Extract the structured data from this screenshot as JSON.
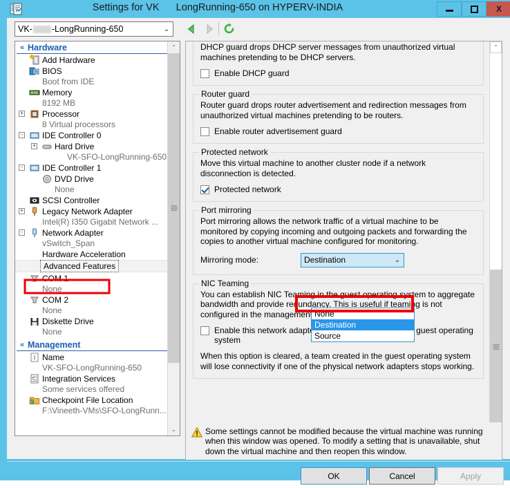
{
  "window": {
    "title": "Settings for VK      LongRunning-650 on HYPERV-INDIA",
    "app_icon": "settings-document-icon",
    "minimize_label": "",
    "maximize_label": "",
    "close_label": "X",
    "accent_color": "#5bc3e8",
    "close_color": "#c7584f"
  },
  "toolbar": {
    "vm_selector_value_prefix": "VK-",
    "vm_selector_value_suffix": "-LongRunning-650",
    "vm_selector_arrow": "⌄",
    "back_icon": "back-arrow-icon",
    "forward_icon": "forward-arrow-icon",
    "refresh_icon": "refresh-icon"
  },
  "sidebar": {
    "sections": [
      {
        "label": "Hardware",
        "chevron": "«",
        "items": [
          {
            "label": "Add Hardware",
            "icon": "add-hardware-icon",
            "sub": null,
            "expander": null,
            "indent": 1
          },
          {
            "label": "BIOS",
            "icon": "bios-icon",
            "sub": "Boot from IDE",
            "expander": null,
            "indent": 1
          },
          {
            "label": "Memory",
            "icon": "memory-icon",
            "sub": "8192 MB",
            "expander": null,
            "indent": 1
          },
          {
            "label": "Processor",
            "icon": "processor-icon",
            "sub": "8 Virtual processors",
            "expander": "+",
            "indent": 1
          },
          {
            "label": "IDE Controller 0",
            "icon": "ide-controller-icon",
            "sub": null,
            "expander": "-",
            "indent": 1
          },
          {
            "label": "Hard Drive",
            "icon": "hard-drive-icon",
            "sub": "VK-SFO-LongRunning-650....",
            "expander": "+",
            "indent": 2
          },
          {
            "label": "IDE Controller 1",
            "icon": "ide-controller-icon",
            "sub": null,
            "expander": "-",
            "indent": 1
          },
          {
            "label": "DVD Drive",
            "icon": "dvd-drive-icon",
            "sub": "None",
            "expander": null,
            "indent": 2
          },
          {
            "label": "SCSI Controller",
            "icon": "scsi-controller-icon",
            "sub": null,
            "expander": null,
            "indent": 1
          },
          {
            "label": "Legacy Network Adapter",
            "icon": "network-adapter-icon",
            "sub": "Intel(R) I350 Gigabit Network ...",
            "expander": "+",
            "indent": 1
          },
          {
            "label": "Network Adapter",
            "icon": "network-adapter-icon",
            "sub": "vSwitch_Span",
            "expander": "-",
            "indent": 1
          },
          {
            "label": "Hardware Acceleration",
            "icon": null,
            "sub": null,
            "expander": null,
            "indent": 1
          },
          {
            "label": "Advanced Features",
            "icon": null,
            "sub": null,
            "expander": null,
            "indent": 1,
            "selected": true,
            "annotated": true
          },
          {
            "label": "COM 1",
            "icon": "com-port-icon",
            "sub": "None",
            "expander": null,
            "indent": 1
          },
          {
            "label": "COM 2",
            "icon": "com-port-icon",
            "sub": "None",
            "expander": null,
            "indent": 1
          },
          {
            "label": "Diskette Drive",
            "icon": "diskette-drive-icon",
            "sub": "None",
            "expander": null,
            "indent": 1
          }
        ]
      },
      {
        "label": "Management",
        "chevron": "«",
        "items": [
          {
            "label": "Name",
            "icon": "name-icon",
            "sub": "VK-SFO-LongRunning-650",
            "expander": null,
            "indent": 1
          },
          {
            "label": "Integration Services",
            "icon": "integration-services-icon",
            "sub": "Some services offered",
            "expander": null,
            "indent": 1
          },
          {
            "label": "Checkpoint File Location",
            "icon": "checkpoint-folder-icon",
            "sub": "F:\\Vineeth-VMs\\SFO-LongRunn...",
            "expander": null,
            "indent": 1
          }
        ]
      }
    ],
    "scroll_up_arrow": "⌃",
    "scroll_down_arrow": "⌄"
  },
  "main": {
    "groups": [
      {
        "title": "",
        "title_hidden": true,
        "text": "DHCP guard drops DHCP server messages from unauthorized virtual machines pretending to be DHCP servers.",
        "checkbox": {
          "label": "Enable DHCP guard",
          "checked": false
        }
      },
      {
        "title": "Router guard",
        "text": "Router guard drops router advertisement and redirection messages from unauthorized virtual machines pretending to be routers.",
        "checkbox": {
          "label": "Enable router advertisement guard",
          "checked": false
        }
      },
      {
        "title": "Protected network",
        "text": "Move this virtual machine to another cluster node if a network disconnection is detected.",
        "checkbox": {
          "label": "Protected network",
          "checked": true
        }
      },
      {
        "title": "Port mirroring",
        "text": "Port mirroring allows the network traffic of a virtual machine to be monitored by copying incoming and outgoing packets and forwarding the copies to another virtual machine configured for monitoring.",
        "mirror_label": "Mirroring mode:",
        "mirror_value": "Destination",
        "mirror_arrow": "⌄"
      },
      {
        "title": "NIC Teaming",
        "text": "You can establish NIC Teaming in the guest operating system to aggregate bandwidth and provide redundancy. This is useful if teaming is not configured in the management operating system.",
        "checkbox": {
          "label": "Enable this network adapter to be part of a team in the guest operating system",
          "checked": false
        },
        "footer_text": "When this option is cleared, a team created in the guest operating system will lose connectivity if one of the physical network adapters stops working."
      }
    ],
    "dropdown_options": [
      {
        "label": "None",
        "selected": false
      },
      {
        "label": "Destination",
        "selected": true
      },
      {
        "label": "Source",
        "selected": false
      }
    ],
    "scroll_up_arrow": "⌃",
    "scroll_down_arrow": "⌄"
  },
  "warning": {
    "icon": "warning-triangle-icon",
    "text": "Some settings cannot be modified because the virtual machine was running when this window was opened. To modify a setting that is unavailable, shut down the virtual machine and then reopen this window."
  },
  "footer": {
    "ok_label": "OK",
    "cancel_label": "Cancel",
    "apply_label": "Apply"
  },
  "watermark": {
    "text": ""
  }
}
